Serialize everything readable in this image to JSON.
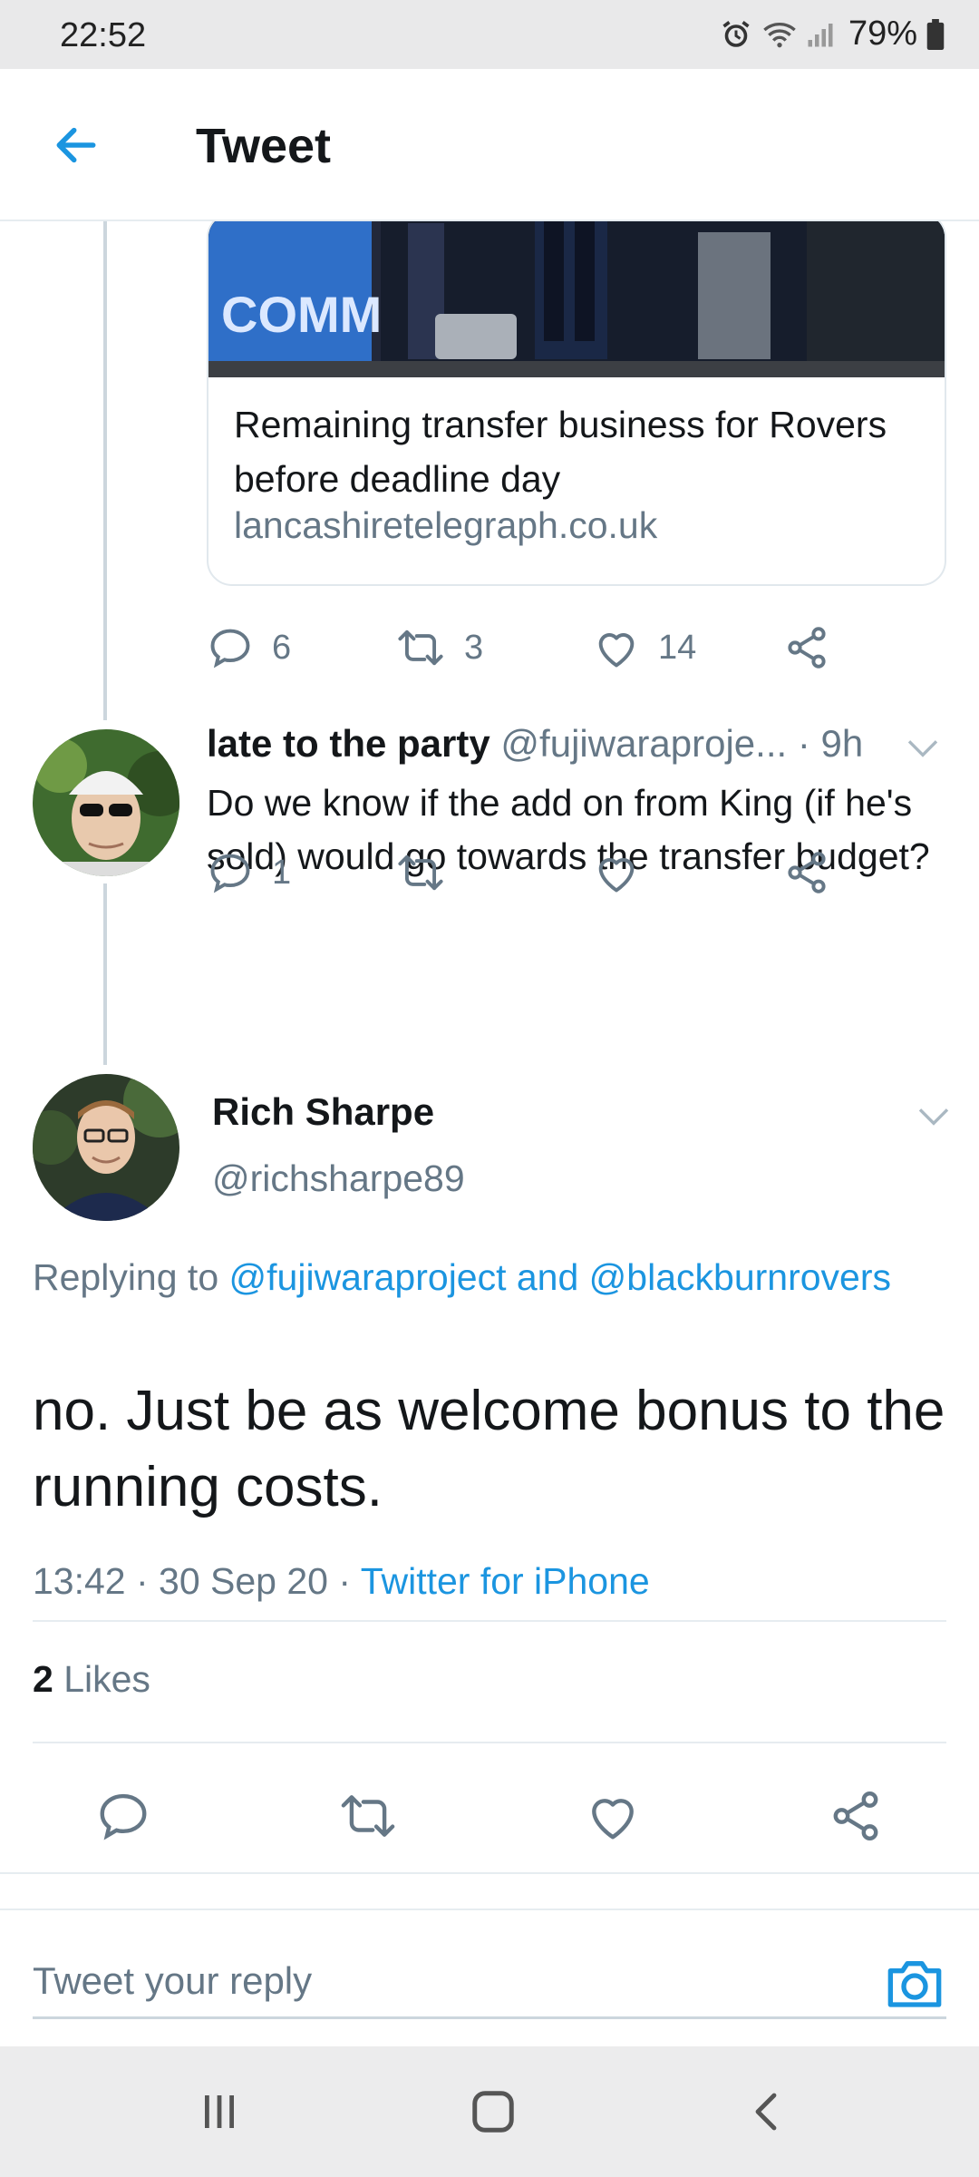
{
  "status_bar": {
    "time": "22:52",
    "battery": "79%"
  },
  "header": {
    "title": "Tweet"
  },
  "link_card": {
    "title": "Remaining transfer business for Rovers before deadline day",
    "domain": "lancashiretelegraph.co.uk",
    "image_text": "COMMERCIA"
  },
  "parent_actions": {
    "replies": "6",
    "retweets": "3",
    "likes": "14"
  },
  "reply_tweet": {
    "name": "late to the party",
    "handle": "@fujiwaraproje...",
    "time": "· 9h",
    "text": "Do we know if the add on from King (if he's sold) would go towards the transfer budget?",
    "replies": "1"
  },
  "main_tweet": {
    "name": "Rich Sharpe",
    "handle": "@richsharpe89",
    "replying_prefix": "Replying to",
    "replying_to": "@fujiwaraproject and @blackburnrovers",
    "text": "no. Just be as welcome bonus to the running costs.",
    "time": "13:42 · 30 Sep 20 · ",
    "source": "Twitter for iPhone",
    "likes_count": "2",
    "likes_label": "Likes"
  },
  "compose": {
    "placeholder": "Tweet your reply"
  },
  "colors": {
    "accent": "#1b95e0",
    "text": "#14171a",
    "secondary": "#657786",
    "border": "#e6ecf0"
  },
  "icons": [
    "back-arrow-icon",
    "reply-icon",
    "retweet-icon",
    "like-icon",
    "share-icon",
    "chevron-down-icon",
    "camera-icon",
    "recents-icon",
    "home-icon",
    "back-nav-icon"
  ]
}
